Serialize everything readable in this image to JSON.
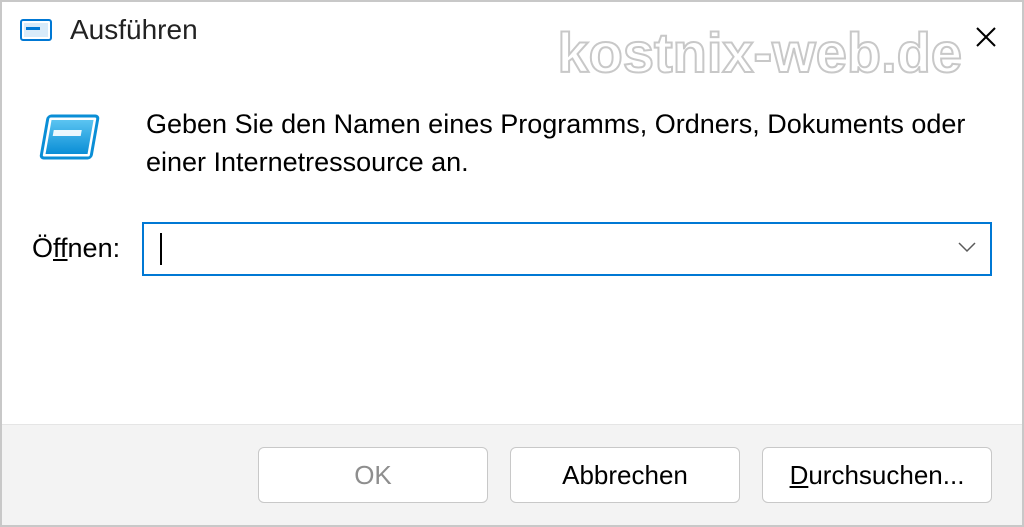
{
  "titlebar": {
    "title": "Ausführen",
    "icon_name": "run-icon"
  },
  "watermark": "kostnix-web.de",
  "content": {
    "description": "Geben Sie den Namen eines Programms, Ordners, Dokuments oder einer Internetressource an.",
    "input_label_prefix": "Ö",
    "input_label_underlined": "ff",
    "input_label_suffix": "nen:",
    "input_value": ""
  },
  "buttons": {
    "ok": "OK",
    "cancel": "Abbrechen",
    "browse_underlined": "D",
    "browse_rest": "urchsuchen..."
  }
}
